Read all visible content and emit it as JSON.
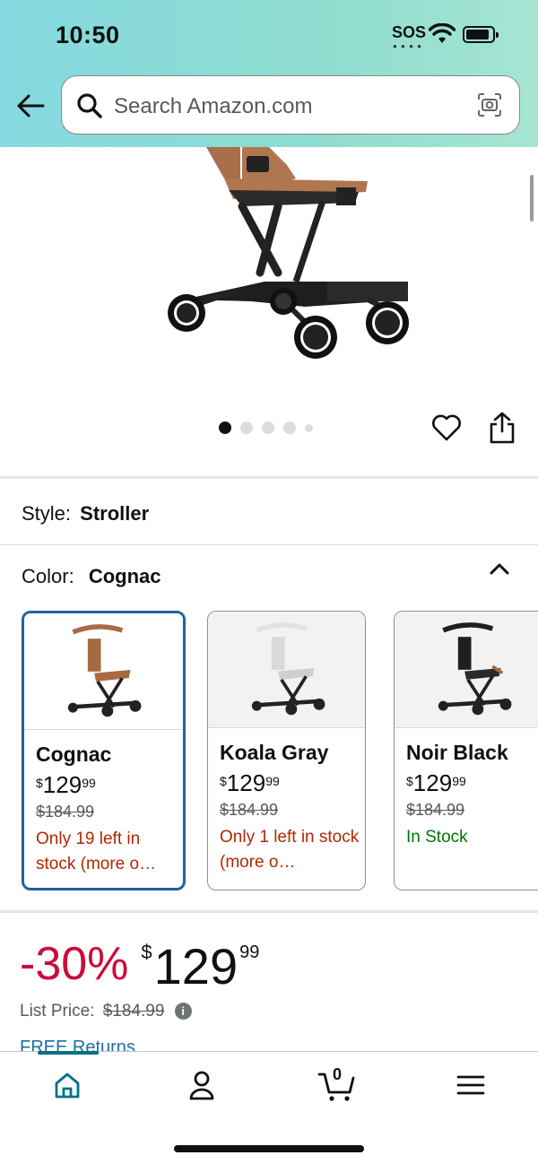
{
  "status": {
    "time": "10:50",
    "sos": "SOS"
  },
  "search": {
    "placeholder": "Search Amazon.com"
  },
  "style": {
    "label": "Style:",
    "value": "Stroller"
  },
  "color": {
    "label": "Color:",
    "value": "Cognac"
  },
  "variants": [
    {
      "name": "Cognac",
      "currency": "$",
      "price_whole": "129",
      "price_cents": "99",
      "list_price": "$184.99",
      "stock": "Only 19 left in stock (more o…",
      "selected": true,
      "accent": "#a86a42"
    },
    {
      "name": "Koala Gray",
      "currency": "$",
      "price_whole": "129",
      "price_cents": "99",
      "list_price": "$184.99",
      "stock": "Only 1 left in stock (more o…",
      "selected": false,
      "accent": "#d9d9d9"
    },
    {
      "name": "Noir Black",
      "currency": "$",
      "price_whole": "129",
      "price_cents": "99",
      "list_price": "$184.99",
      "stock": "In Stock",
      "selected": false,
      "accent": "#1f1f1f"
    }
  ],
  "deal": {
    "discount": "-30%",
    "currency": "$",
    "price_whole": "129",
    "price_cents": "99"
  },
  "list_price": {
    "label": "List Price:",
    "value": "$184.99"
  },
  "free_returns": "FREE Returns",
  "carousel": {
    "count": 5,
    "active": 0
  },
  "colors": {
    "accent_teal": "#007185",
    "deal_red": "#cc0c39",
    "stock_red": "#b12704",
    "stock_green": "#007600",
    "selected_border": "#2162a1"
  },
  "icons": [
    "back-arrow-icon",
    "search-icon",
    "camera-icon",
    "heart-icon",
    "share-icon",
    "chevron-up-icon",
    "home-icon",
    "account-icon",
    "cart-icon",
    "menu-icon"
  ],
  "cart": {
    "count": "0"
  }
}
